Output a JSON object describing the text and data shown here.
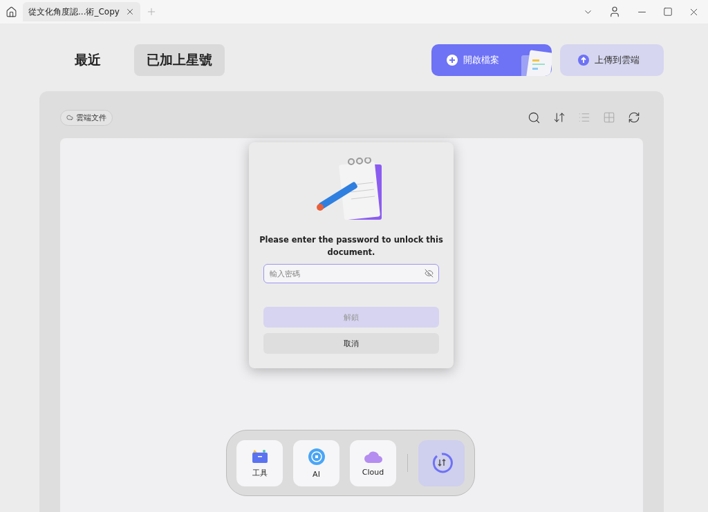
{
  "tabs": [
    {
      "label": "從文化角度認...術_Copy",
      "selected": true
    }
  ],
  "nav_tabs": [
    {
      "label": "最近",
      "selected": false
    },
    {
      "label": "已加上星號",
      "selected": true
    }
  ],
  "actions": [
    {
      "label": "開啟檔案",
      "kind": "primary"
    },
    {
      "label": "上傳到雲端",
      "kind": "secondary"
    }
  ],
  "filter_chip": "雲端文件",
  "dialog": {
    "message": "Please enter the password to unlock this document.",
    "password": {
      "placeholder": "輸入密碼"
    },
    "buttons": [
      {
        "label": "解鎖",
        "disabled": true
      },
      {
        "label": "取消",
        "disabled": false
      }
    ]
  },
  "dock": [
    {
      "label": "工具",
      "kind": "tools"
    },
    {
      "label": "AI",
      "kind": "ai"
    },
    {
      "label": "Cloud",
      "kind": "cloud"
    }
  ]
}
